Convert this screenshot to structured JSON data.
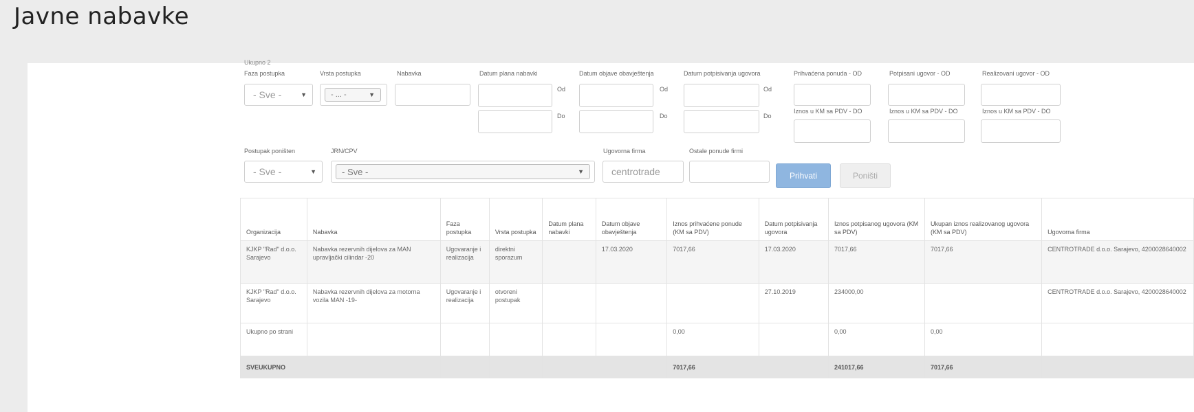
{
  "page": {
    "title": "Javne nabavke"
  },
  "summary": {
    "count_label": "Ukupno 2"
  },
  "filters": {
    "faza": {
      "label": "Faza postupka",
      "value": "- Sve -"
    },
    "vrsta": {
      "label": "Vrsta postupka",
      "value": "- ... -"
    },
    "nabavka": {
      "label": "Nabavka",
      "value": ""
    },
    "datum_plana": {
      "label": "Datum plana nabavki",
      "od": "Od",
      "do": "Do"
    },
    "datum_objave": {
      "label": "Datum objave obavještenja",
      "od": "Od",
      "do": "Do"
    },
    "datum_potpisivanja": {
      "label": "Datum potpisivanja ugovora",
      "od": "Od",
      "do": "Do"
    },
    "prihvacena": {
      "label": "Prihvaćena ponuda - OD",
      "label2": "Iznos u KM sa PDV - DO"
    },
    "potpisani": {
      "label": "Potpisani ugovor - OD",
      "label2": "Iznos u KM sa PDV - DO"
    },
    "realizovani": {
      "label": "Realizovani ugovor - OD",
      "label2": "Iznos u KM sa PDV - DO"
    },
    "ponisten": {
      "label": "Postupak poništen",
      "value": "- Sve -"
    },
    "jrn": {
      "label": "JRN/CPV",
      "value": "- Sve -"
    },
    "ugovorna_firma": {
      "label": "Ugovorna firma",
      "value": "centrotrade"
    },
    "ostale": {
      "label": "Ostale ponude firmi",
      "value": ""
    }
  },
  "buttons": {
    "prihvati": "Prihvati",
    "ponisti": "Poništi"
  },
  "table": {
    "headers": [
      "Organizacija",
      "Nabavka",
      "Faza postupka",
      "Vrsta postupka",
      "Datum plana nabavki",
      "Datum objave obavještenja",
      "Iznos prihvaćene ponude (KM sa PDV)",
      "Datum potpisivanja ugovora",
      "Iznos potpisanog ugovora (KM sa PDV)",
      "Ukupan iznos realizovanog ugovora (KM sa PDV)",
      "Ugovorna firma"
    ],
    "rows": [
      [
        "KJKP \"Rad\" d.o.o. Sarajevo",
        "Nabavka rezervnih dijelova za MAN upravljački cilindar -20",
        "Ugovaranje i realizacija",
        "direktni sporazum",
        "",
        "17.03.2020",
        "7017,66",
        "17.03.2020",
        "7017,66",
        "7017,66",
        "CENTROTRADE d.o.o. Sarajevo, 4200028640002"
      ],
      [
        "KJKP \"Rad\" d.o.o. Sarajevo",
        "Nabavka rezervnih dijelova za motorna vozila MAN -19-",
        "Ugovaranje i realizacija",
        "otvoreni postupak",
        "",
        "",
        "",
        "27.10.2019",
        "234000,00",
        "",
        "CENTROTRADE d.o.o. Sarajevo, 4200028640002"
      ]
    ],
    "page_total": [
      "Ukupno po strani",
      "",
      "",
      "",
      "",
      "",
      "0,00",
      "",
      "0,00",
      "0,00",
      ""
    ],
    "grand_total": [
      "SVEUKUPNO",
      "",
      "",
      "",
      "",
      "",
      "7017,66",
      "",
      "241017,66",
      "7017,66",
      ""
    ]
  }
}
